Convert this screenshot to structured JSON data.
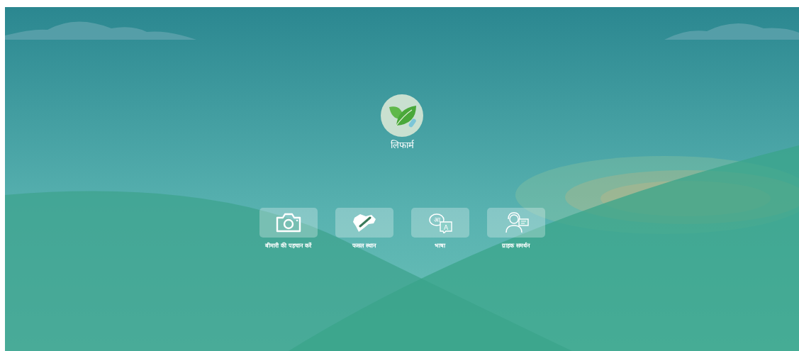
{
  "app": {
    "name": "लिफार्म"
  },
  "menu": [
    {
      "kind": "camera",
      "label": "बीमारी की पहचान करें"
    },
    {
      "kind": "map",
      "label": "फसल स्थान"
    },
    {
      "kind": "language",
      "label": "भाषा",
      "glyphs": [
        "आ",
        "A"
      ]
    },
    {
      "kind": "support",
      "label": "ग्राहक समर्थन"
    }
  ]
}
